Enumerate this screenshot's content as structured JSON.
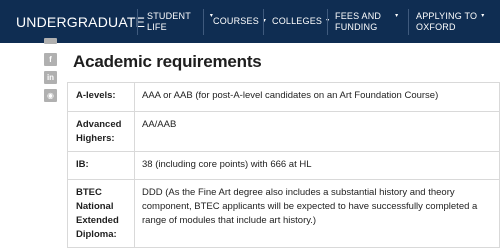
{
  "nav": {
    "section_title": "UNDERGRADUATE",
    "items": [
      {
        "line1": "STUDENT",
        "line2": "LIFE",
        "caret": "▾"
      },
      {
        "line1": "COURSES",
        "line2": "",
        "caret": "▾"
      },
      {
        "line1": "COLLEGES",
        "line2": "",
        "caret": "▾"
      },
      {
        "line1": "FEES AND",
        "line2": "FUNDING",
        "caret": "▾"
      },
      {
        "line1": "APPLYING TO",
        "line2": "OXFORD",
        "caret": "▾"
      }
    ]
  },
  "social": {
    "icons": [
      {
        "glyph": "f"
      },
      {
        "glyph": "in"
      },
      {
        "glyph": "◉"
      }
    ]
  },
  "page": {
    "title": "Academic requirements"
  },
  "requirements": [
    {
      "label": "A-levels:",
      "value": "AAA or AAB (for post-A-level candidates on an Art Foundation Course)"
    },
    {
      "label": "Advanced Highers:",
      "value": "AA/AAB"
    },
    {
      "label": "IB:",
      "value": "38 (including core points) with 666 at HL"
    },
    {
      "label": "BTEC National Extended Diploma:",
      "value": "DDD (As the Fine Art degree also includes a substantial history and theory component, BTEC applicants will be expected to have successfully completed a range of modules that include art history.)"
    }
  ],
  "colors": {
    "nav_bg": "#0f2d52",
    "nav_text": "#ffffff",
    "border": "#d9d9d9",
    "social_icon": "#b0b0b0"
  }
}
